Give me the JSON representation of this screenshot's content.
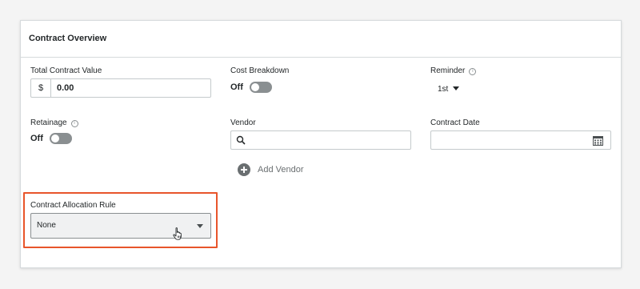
{
  "card": {
    "title": "Contract Overview"
  },
  "fields": {
    "total_contract_value": {
      "label": "Total Contract Value",
      "prefix": "$",
      "value": "0.00"
    },
    "cost_breakdown": {
      "label": "Cost Breakdown",
      "state": "Off"
    },
    "reminder": {
      "label": "Reminder",
      "value": "1st"
    },
    "retainage": {
      "label": "Retainage",
      "state": "Off"
    },
    "vendor": {
      "label": "Vendor",
      "value": ""
    },
    "contract_date": {
      "label": "Contract Date",
      "value": ""
    },
    "add_vendor": {
      "label": "Add Vendor"
    },
    "contract_allocation_rule": {
      "label": "Contract Allocation Rule",
      "value": "None"
    }
  },
  "colors": {
    "highlight": "#e8552b",
    "toggle_off": "#8a8f91",
    "text": "#232729"
  },
  "icons": [
    "info-icon",
    "search-icon",
    "calendar-icon",
    "plus-icon",
    "chevron-down-icon",
    "hand-cursor-icon"
  ]
}
